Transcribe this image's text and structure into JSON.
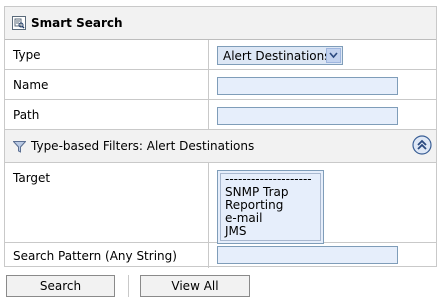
{
  "panel": {
    "title": "Smart Search",
    "title_icon": "search-form-icon"
  },
  "fields": {
    "type_label": "Type",
    "type_value": "Alert Destinations",
    "name_label": "Name",
    "name_value": "",
    "path_label": "Path",
    "path_value": ""
  },
  "filters": {
    "header": "Type-based Filters: Alert Destinations",
    "filter_icon": "funnel-icon",
    "collapse_icon": "double-chevron-up-icon",
    "target_label": "Target",
    "target_options": [
      "--------------------",
      "SNMP Trap",
      "Reporting",
      "e-mail",
      "JMS"
    ],
    "pattern_label": "Search Pattern (Any String)",
    "pattern_value": ""
  },
  "actions": {
    "search_label": "Search",
    "view_all_label": "View All"
  },
  "colors": {
    "input_bg": "#e6eefb",
    "input_border": "#7f9db9",
    "header_bg": "#f2f2f2",
    "accent": "#3a6fb8"
  }
}
